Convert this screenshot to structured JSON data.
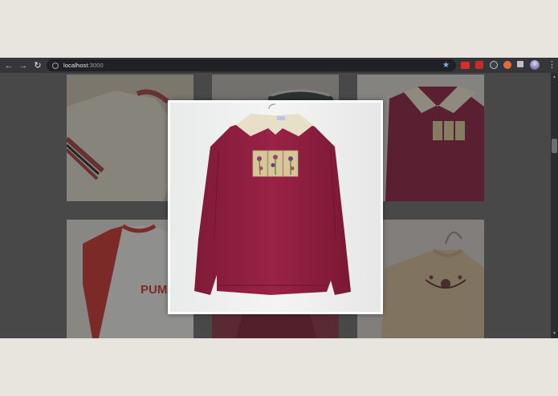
{
  "browser": {
    "url_host": "localhost",
    "url_port": ":3000",
    "bookmark_icon": "star-icon",
    "extensions": [
      "adblock-icon",
      "lastpass-icon",
      "privacy-badger-icon",
      "shield-icon",
      "puzzle-icon"
    ],
    "menu_icon": "kebab-menu-icon"
  },
  "gallery": {
    "items": [
      {
        "name": "cream-sweatshirt-striped-cuff",
        "colors": [
          "#d8d2c2",
          "#a83b3b"
        ]
      },
      {
        "name": "grey-sweater-collar",
        "colors": [
          "#bfbcb5",
          "#2b3a3b"
        ]
      },
      {
        "name": "maroon-sweatshirt-embroidered",
        "colors": [
          "#8a1f3d",
          "#e6dfc8"
        ]
      },
      {
        "name": "puma-raglan-tee",
        "colors": [
          "#e5e3df",
          "#c53a35"
        ]
      },
      {
        "name": "maroon-garment",
        "colors": [
          "#7c2438"
        ]
      },
      {
        "name": "beige-embroidered-top",
        "colors": [
          "#cdb89a",
          "#6a3a3a"
        ]
      }
    ],
    "modal_item": "maroon-sweatshirt-embroidered",
    "puma_text": "PUMA"
  },
  "colors": {
    "accent": "#8ab4f8",
    "maroon": "#8b1e3f",
    "collar": "#e8dfc6"
  }
}
